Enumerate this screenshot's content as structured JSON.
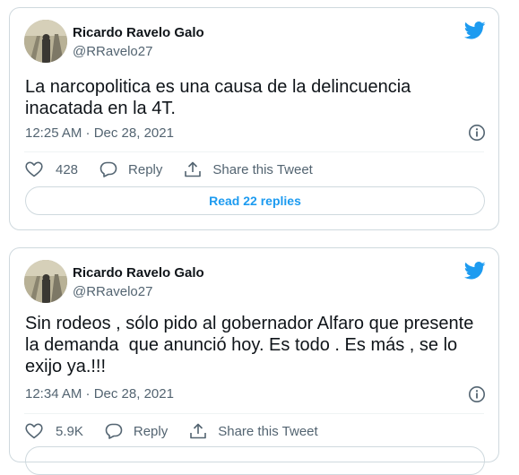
{
  "tweets": [
    {
      "author_name": "Ricardo Ravelo Galo",
      "author_handle": "@RRavelo27",
      "text": "La narcopolitica es una causa de la delincuencia inacatada en la 4T.",
      "timestamp": "12:25 AM · Dec 28, 2021",
      "likes": "428",
      "reply_label": "Reply",
      "share_label": "Share this Tweet",
      "replies_button": "Read 22 replies"
    },
    {
      "author_name": "Ricardo Ravelo Galo",
      "author_handle": "@RRavelo27",
      "text": "Sin rodeos , sólo pido al gobernador Alfaro que presente la demanda  que anunció hoy. Es todo . Es más , se lo exijo ya.!!!",
      "timestamp": "12:34 AM · Dec 28, 2021",
      "likes": "5.9K",
      "reply_label": "Reply",
      "share_label": "Share this Tweet",
      "replies_button": ""
    }
  ],
  "icons": {
    "brand": "twitter-bird-icon",
    "like": "heart-icon",
    "reply": "speech-bubble-icon",
    "share": "share-upload-icon",
    "info": "info-icon"
  },
  "colors": {
    "brand_blue": "#1d9bf0",
    "text_primary": "#0f1419",
    "text_secondary": "#536471",
    "border": "#cfd9de"
  }
}
